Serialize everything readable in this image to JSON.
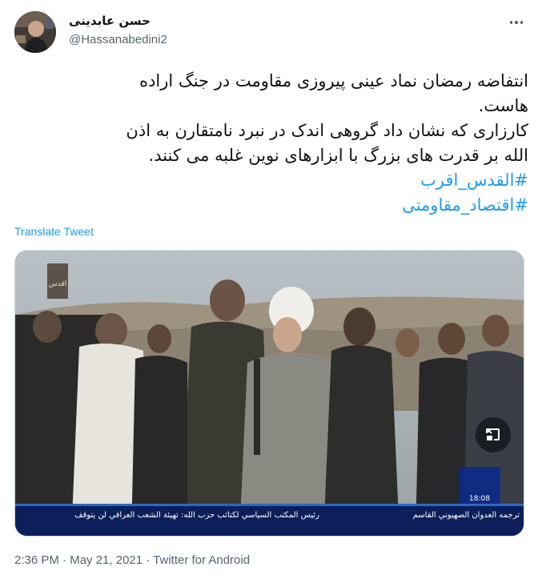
{
  "author": {
    "display_name": "حسن عابدینی",
    "handle": "@Hassanabedini2"
  },
  "tweet": {
    "lines": [
      "انتفاضه رمضان نماد عینی پیروزی مقاومت در جنگ اراده",
      "هاست.",
      "کارزاری که نشان داد گروهی اندک در نبرد نامتقارن به اذن",
      "الله بر قدرت های بزرگ با ابزارهای نوین غلبه می کنند."
    ],
    "hashtags": [
      "#القدس_اقرب",
      "#اقتصاد_مقاومتی"
    ]
  },
  "translate_label": "Translate Tweet",
  "media": {
    "channel_logo_text": "اقدس",
    "ticker_text": "رئيس المكتب السياسي لكتائب حزب الله: تهيئة الشعب العراقي لن يتوقف",
    "ticker_right": "ترجمه العدوان الصهيوني القاسم",
    "clock": "18:08"
  },
  "meta": {
    "time": "2:36 PM",
    "date": "May 21, 2021",
    "separator": "·",
    "source": "Twitter for Android"
  },
  "icons": {
    "more": "more-horizontal-icon",
    "pip": "picture-in-picture-icon"
  }
}
